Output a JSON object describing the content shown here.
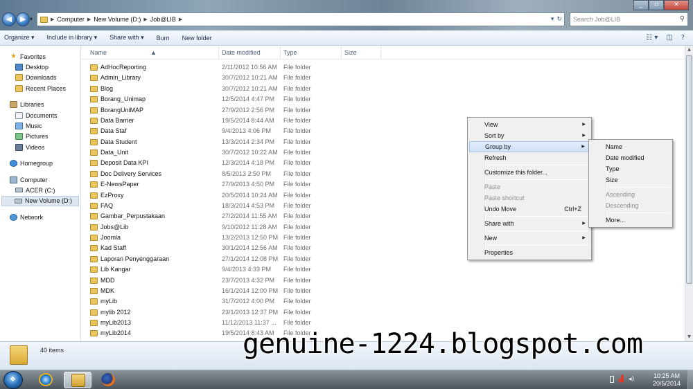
{
  "address": {
    "crumbs": [
      "Computer",
      "New Volume (D:)",
      "Job@LIB"
    ],
    "search_placeholder": "Search Job@LIB"
  },
  "toolbar": {
    "organize": "Organize ▾",
    "include_in_library": "Include in library ▾",
    "share_with": "Share with ▾",
    "burn": "Burn",
    "new_folder": "New folder"
  },
  "nav": {
    "favorites": "Favorites",
    "desktop": "Desktop",
    "downloads": "Downloads",
    "recent_places": "Recent Places",
    "libraries": "Libraries",
    "documents": "Documents",
    "music": "Music",
    "pictures": "Pictures",
    "videos": "Videos",
    "homegroup": "Homegroup",
    "computer": "Computer",
    "acer": "ACER (C:)",
    "new_volume": "New Volume (D:)",
    "network": "Network"
  },
  "columns": {
    "name": "Name",
    "date": "Date modified",
    "type": "Type",
    "size": "Size"
  },
  "files": [
    {
      "name": "AdHocReporting",
      "date": "2/11/2012 10:56 AM",
      "type": "File folder"
    },
    {
      "name": "Admin_Library",
      "date": "30/7/2012 10:21 AM",
      "type": "File folder"
    },
    {
      "name": "Blog",
      "date": "30/7/2012 10:21 AM",
      "type": "File folder"
    },
    {
      "name": "Borang_Unimap",
      "date": "12/5/2014 4:47 PM",
      "type": "File folder"
    },
    {
      "name": "BorangUniMAP",
      "date": "27/9/2012 2:56 PM",
      "type": "File folder"
    },
    {
      "name": "Data Barrier",
      "date": "19/5/2014 8:44 AM",
      "type": "File folder"
    },
    {
      "name": "Data Staf",
      "date": "9/4/2013 4:06 PM",
      "type": "File folder"
    },
    {
      "name": "Data Student",
      "date": "13/3/2014 2:34 PM",
      "type": "File folder"
    },
    {
      "name": "Data_Unit",
      "date": "30/7/2012 10:22 AM",
      "type": "File folder"
    },
    {
      "name": "Deposit Data KPI",
      "date": "12/3/2014 4:18 PM",
      "type": "File folder"
    },
    {
      "name": "Doc Delivery Services",
      "date": "8/5/2013 2:50 PM",
      "type": "File folder"
    },
    {
      "name": "E-NewsPaper",
      "date": "27/9/2013 4:50 PM",
      "type": "File folder"
    },
    {
      "name": "EzProxy",
      "date": "20/5/2014 10:24 AM",
      "type": "File folder"
    },
    {
      "name": "FAQ",
      "date": "18/3/2014 4:53 PM",
      "type": "File folder"
    },
    {
      "name": "Gambar_Perpustakaan",
      "date": "27/2/2014 11:55 AM",
      "type": "File folder"
    },
    {
      "name": "Jobs@Lib",
      "date": "9/10/2012 11:28 AM",
      "type": "File folder"
    },
    {
      "name": "Joomla",
      "date": "13/2/2013 12:50 PM",
      "type": "File folder"
    },
    {
      "name": "Kad Staff",
      "date": "30/1/2014 12:56 AM",
      "type": "File folder"
    },
    {
      "name": "Laporan Penyenggaraan",
      "date": "27/1/2014 12:08 PM",
      "type": "File folder"
    },
    {
      "name": "Lib Kangar",
      "date": "9/4/2013 4:33 PM",
      "type": "File folder"
    },
    {
      "name": "MDD",
      "date": "23/7/2013 4:32 PM",
      "type": "File folder"
    },
    {
      "name": "MDK",
      "date": "16/1/2014 12:00 PM",
      "type": "File folder"
    },
    {
      "name": "myLib",
      "date": "31/7/2012 4:00 PM",
      "type": "File folder"
    },
    {
      "name": "mylib 2012",
      "date": "23/1/2013 12:37 PM",
      "type": "File folder"
    },
    {
      "name": "myLib2013",
      "date": "11/12/2013 11:37 ...",
      "type": "File folder"
    },
    {
      "name": "myLib2014",
      "date": "19/5/2014 8:43 AM",
      "type": "File folder"
    }
  ],
  "details": {
    "count": "40 items"
  },
  "context_menu": {
    "view": "View",
    "sort_by": "Sort by",
    "group_by": "Group by",
    "refresh": "Refresh",
    "customize": "Customize this folder...",
    "paste": "Paste",
    "paste_shortcut": "Paste shortcut",
    "undo_move": "Undo Move",
    "undo_shortcut": "Ctrl+Z",
    "share_with": "Share with",
    "new": "New",
    "properties": "Properties"
  },
  "group_submenu": {
    "name": "Name",
    "date_modified": "Date modified",
    "type": "Type",
    "size": "Size",
    "ascending": "Ascending",
    "descending": "Descending",
    "more": "More..."
  },
  "watermark": "genuine-1224.blogspot.com",
  "taskbar": {
    "time": "10:25 AM",
    "date": "20/5/2014"
  }
}
